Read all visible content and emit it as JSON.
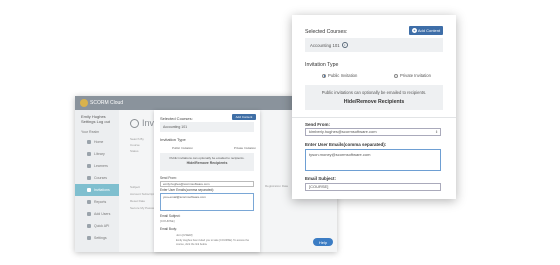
{
  "background_app": {
    "logo_text": "SCORM Cloud",
    "user_name": "Emily Hughes",
    "user_sub": "Settings  Log out",
    "nav_label": "Your Realm",
    "nav_items": [
      "Home",
      "Library",
      "Learners",
      "Courses",
      "Invitations",
      "Reports",
      "Add Users",
      "Quick API",
      "Settings"
    ],
    "active_nav_index": 4,
    "page_title": "Invit",
    "labels": [
      "Search By",
      "Course",
      "Status"
    ],
    "side_labels": [
      "Subject",
      "Account Subscription",
      "Reset Date",
      "Secure My Password"
    ],
    "right_col_label": "Registration Date",
    "help_label": "Help"
  },
  "middle_panel": {
    "selected_courses_title": "Selected Courses:",
    "add_content_label": "Add Content",
    "course_name": "Accounting 101",
    "invitation_type_title": "Invitation Type",
    "public_label": "Public Invitation",
    "private_label": "Private Invitation",
    "note": "Public invitations can optionally be emailed to recipients.",
    "hide_label": "Hide/Remove Recipients",
    "send_from_label": "Send From:",
    "send_from_value": "emily.hughes@scormsoftware.com",
    "emails_label": "Enter User Emails(comma separated):",
    "emails_value": "you+email@scormsoftware.com",
    "subject_label": "Email Subject:",
    "subject_value": "[COURSE]",
    "body_label": "Email Body:",
    "body_value_1": "Join [USER]:",
    "body_value_2": "Emily Hughes has invited you to take [COURSE]. To access the course, click the link below."
  },
  "front_panel": {
    "selected_courses_title": "Selected Courses:",
    "add_content_label": "Add Content",
    "course_name": "Accounting 101",
    "invitation_type_title": "Invitation Type",
    "public_label": "Public Invitation",
    "private_label": "Private Invitation",
    "selected_type": "public",
    "note": "Public invitations can optionally be emailed to recipients.",
    "hide_label": "Hide/Remove Recipients",
    "send_from_label": "Send From:",
    "send_from_value": "kimberly.hughes@scormsoftware.com",
    "emails_label": "Enter User Emails(comma separated):",
    "emails_value": "tyson.money@scormsoftware.com",
    "subject_label": "Email Subject:",
    "subject_value": "[COURSE]"
  },
  "colors": {
    "accent_blue": "#3e6ea8",
    "active_nav": "#7fbfcf",
    "topbar": "#8a939c"
  }
}
